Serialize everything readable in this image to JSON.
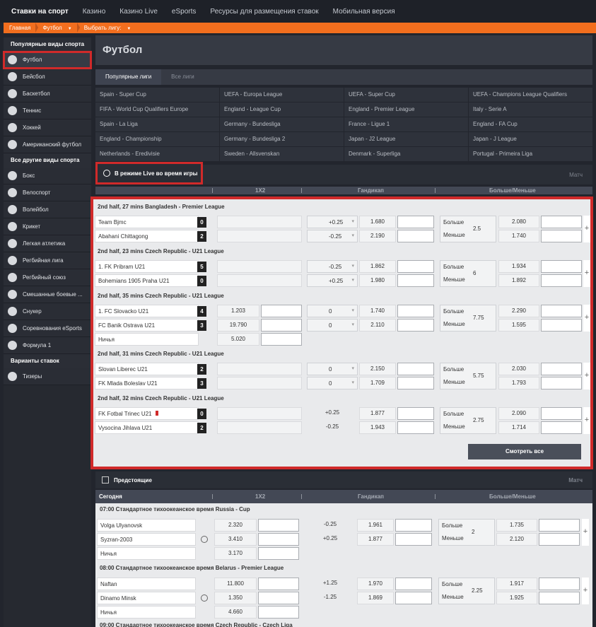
{
  "topnav": [
    "Ставки на спорт",
    "Казино",
    "Казино Live",
    "eSports",
    "Ресурсы для размещения ставок",
    "Мобильная версия"
  ],
  "breadcrumbs": [
    "Главная",
    "Футбол",
    "Выбрать лигу:"
  ],
  "sidebar": {
    "popular_title": "Популярные виды спорта",
    "popular": [
      "Футбол",
      "Бейсбол",
      "Баскетбол",
      "Теннис",
      "Хоккей",
      "Американский футбол"
    ],
    "other_title": "Все другие виды спорта",
    "other": [
      "Бокс",
      "Велоспорт",
      "Волейбол",
      "Крикет",
      "Легкая атлетика",
      "Регбийная лига",
      "Регбийный союз",
      "Смешанные боевые ...",
      "Снукер",
      "Соревнования eSports",
      "Формула 1"
    ],
    "bet_title": "Варианты ставок",
    "bet": [
      "Тизеры"
    ]
  },
  "page_title": "Футбол",
  "tabs": [
    "Популярные лиги",
    "Все лиги"
  ],
  "leagues": [
    "Spain - Super Cup",
    "UEFA - Europa League",
    "UEFA - Super Cup",
    "UEFA - Champions League Qualifiers",
    "FIFA - World Cup Qualifiers Europe",
    "England - League Cup",
    "England - Premier League",
    "Italy - Serie A",
    "Spain - La Liga",
    "Germany - Bundesliga",
    "France - Ligue 1",
    "England - FA Cup",
    "England - Championship",
    "Germany - Bundesliga 2",
    "Japan - J2 League",
    "Japan - J League",
    "Netherlands - Eredivisie",
    "Sweden - Allsvenskan",
    "Denmark - Superliga",
    "Portugal - Primeira Liga"
  ],
  "live": {
    "title": "В режиме Live во время игры",
    "right": "Матч",
    "columns": [
      "1X2",
      "Гандикап",
      "Больше/Меньше"
    ],
    "view_all": "Смотреть все",
    "matches": [
      {
        "header": "2nd half, 27 mins   Bangladesh - Premier League",
        "t1": "Team Bjmc",
        "s1": "0",
        "t2": "Abahani Chittagong",
        "s2": "2",
        "h1": "+0.25",
        "h1o": "1.680",
        "h2": "-0.25",
        "h2o": "2.190",
        "ou": "2.5",
        "o": "2.080",
        "u": "1.740"
      },
      {
        "header": "2nd half, 23 mins   Czech Republic - U21 League",
        "t1": "1. FK Pribram U21",
        "s1": "5",
        "t2": "Bohemians 1905 Praha U21",
        "s2": "0",
        "h1": "-0.25",
        "h1o": "1.862",
        "h2": "+0.25",
        "h2o": "1.980",
        "ou": "6",
        "o": "1.934",
        "u": "1.892"
      },
      {
        "header": "2nd half, 35 mins   Czech Republic - U21 League",
        "t1": "1. FC Slovacko U21",
        "s1": "4",
        "t2": "FC Banik Ostrava U21",
        "s2": "3",
        "x1": "1.203",
        "x2": "19.790",
        "draw": "Ничья",
        "xd": "5.020",
        "h1": "0",
        "h1o": "1.740",
        "h2": "0",
        "h2o": "2.110",
        "ou": "7.75",
        "o": "2.290",
        "u": "1.595"
      },
      {
        "header": "2nd half, 31 mins   Czech Republic - U21 League",
        "t1": "Slovan Liberec U21",
        "s1": "2",
        "t2": "FK Mlada Boleslav U21",
        "s2": "3",
        "h1": "0",
        "h1o": "2.150",
        "h2": "0",
        "h2o": "1.709",
        "ou": "5.75",
        "o": "2.030",
        "u": "1.793"
      },
      {
        "header": "2nd half, 32 mins   Czech Republic - U21 League",
        "t1": "FK Fotbal Trinec U21",
        "s1": "0",
        "t2": "Vysocina Jihlava U21",
        "s2": "2",
        "h1": "+0.25",
        "h1o": "1.877",
        "h2": "-0.25",
        "h2o": "1.943",
        "ou": "2.75",
        "o": "2.090",
        "u": "1.714"
      }
    ]
  },
  "upcoming": {
    "title": "Предстоящие",
    "right": "Матч",
    "today": "Сегодня",
    "matches": [
      {
        "header": "07:00 Стандартное тихоокеанское время Russia - Cup",
        "t1": "Volga Ulyanovsk",
        "x1": "2.320",
        "t2": "Syzran-2003",
        "x2": "3.410",
        "draw": "Ничья",
        "xd": "3.170",
        "h1": "-0.25",
        "h1o": "1.961",
        "h2": "+0.25",
        "h2o": "1.877",
        "ou": "2",
        "o": "1.735",
        "u": "2.120"
      },
      {
        "header": "08:00 Стандартное тихоокеанское время Belarus - Premier League",
        "t1": "Naftan",
        "x1": "11.800",
        "t2": "Dinamo Minsk",
        "x2": "1.350",
        "draw": "Ничья",
        "xd": "4.660",
        "h1": "+1.25",
        "h1o": "1.970",
        "h2": "-1.25",
        "h2o": "1.869",
        "ou": "2.25",
        "o": "1.917",
        "u": "1.925"
      }
    ],
    "partial": "09:00 Стандартное тихоокеанское время Czech Republic - Czech Liga"
  },
  "labels": {
    "over": "Больше",
    "under": "Меньше"
  }
}
